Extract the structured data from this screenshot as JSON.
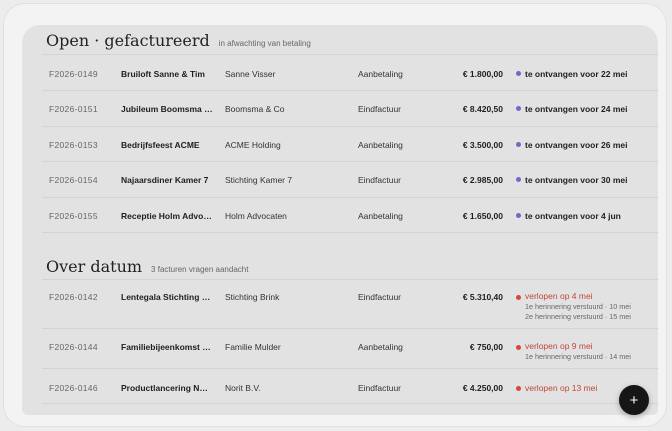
{
  "open_section": {
    "title": "Open · gefactureerd",
    "subtitle": "in afwachting van betaling",
    "rows": [
      {
        "no": "F2026-0149",
        "event": "Bruiloft Sanne & Tim",
        "client": "Sanne Visser",
        "type": "Aanbetaling",
        "amount": "€ 1.800,00",
        "status": "te ontvangen voor 22 mei"
      },
      {
        "no": "F2026-0151",
        "event": "Jubileum Boomsma & Co",
        "client": "Boomsma & Co",
        "type": "Eindfactuur",
        "amount": "€ 8.420,50",
        "status": "te ontvangen voor 24 mei"
      },
      {
        "no": "F2026-0153",
        "event": "Bedrijfsfeest ACME",
        "client": "ACME Holding",
        "type": "Aanbetaling",
        "amount": "€ 3.500,00",
        "status": "te ontvangen voor 26 mei"
      },
      {
        "no": "F2026-0154",
        "event": "Najaarsdiner Kamer 7",
        "client": "Stichting Kamer 7",
        "type": "Eindfactuur",
        "amount": "€ 2.985,00",
        "status": "te ontvangen voor 30 mei"
      },
      {
        "no": "F2026-0155",
        "event": "Receptie Holm Advocaten",
        "client": "Holm Advocaten",
        "type": "Aanbetaling",
        "amount": "€ 1.650,00",
        "status": "te ontvangen voor 4 jun"
      }
    ]
  },
  "overdue_section": {
    "title": "Over datum",
    "subtitle": "3 facturen vragen aandacht",
    "rows": [
      {
        "no": "F2026-0142",
        "event": "Lentegala Stichting Brink",
        "client": "Stichting Brink",
        "type": "Eindfactuur",
        "amount": "€ 5.310,40",
        "status": "verlopen op 4 mei",
        "notes": [
          "1e herinnering verstuurd · 10 mei",
          "2e herinnering verstuurd · 15 mei"
        ]
      },
      {
        "no": "F2026-0144",
        "event": "Familiebijeenkomst Mulder",
        "client": "Familie Mulder",
        "type": "Aanbetaling",
        "amount": "€ 750,00",
        "status": "verlopen op 9 mei",
        "notes": [
          "1e herinnering verstuurd · 14 mei"
        ]
      },
      {
        "no": "F2026-0146",
        "event": "Productlancering Norit",
        "client": "Norit B.V.",
        "type": "Eindfactuur",
        "amount": "€ 4.250,00",
        "status": "verlopen op 13 mei",
        "notes": []
      }
    ]
  },
  "fab": {
    "label": "+"
  },
  "colors": {
    "accent_open": "#6b6bc9",
    "accent_overdue": "#d9453a",
    "overdue_text": "#c0473a"
  }
}
